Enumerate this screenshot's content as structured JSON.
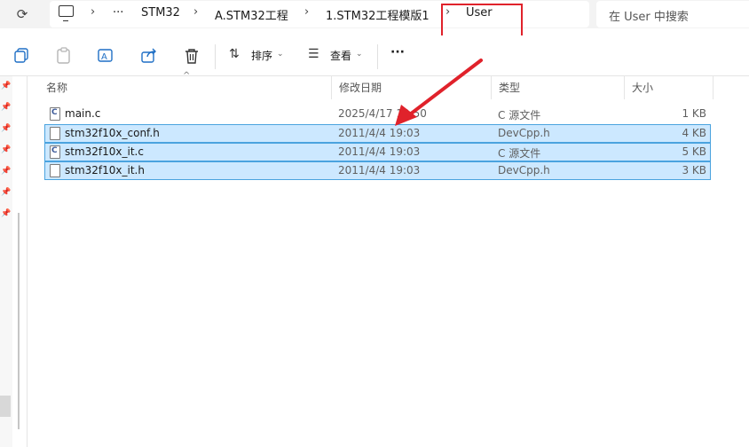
{
  "address": {
    "crumbs": [
      "STM32",
      "A.STM32工程",
      "1.STM32工程模版1",
      "User"
    ],
    "overflow": "···",
    "search_placeholder": "在 User 中搜索"
  },
  "toolbar": {
    "sort_label": "排序",
    "view_label": "查看",
    "more_label": "···"
  },
  "columns": {
    "name": "名称",
    "date": "修改日期",
    "type": "类型",
    "size": "大小"
  },
  "files": [
    {
      "name": "main.c",
      "date": "2025/4/17 12:50",
      "type": "C 源文件",
      "size": "1 KB",
      "icon": "c-source-file-icon",
      "selected": false
    },
    {
      "name": "stm32f10x_conf.h",
      "date": "2011/4/4 19:03",
      "type": "DevCpp.h",
      "size": "4 KB",
      "icon": "header-file-icon",
      "selected": true
    },
    {
      "name": "stm32f10x_it.c",
      "date": "2011/4/4 19:03",
      "type": "C 源文件",
      "size": "5 KB",
      "icon": "c-source-file-icon",
      "selected": true
    },
    {
      "name": "stm32f10x_it.h",
      "date": "2011/4/4 19:03",
      "type": "DevCpp.h",
      "size": "3 KB",
      "icon": "header-file-icon",
      "selected": true
    }
  ],
  "colors": {
    "selection_bg": "#cce8ff",
    "selection_border": "#4aa3df",
    "annotation_red": "#e0222b"
  }
}
